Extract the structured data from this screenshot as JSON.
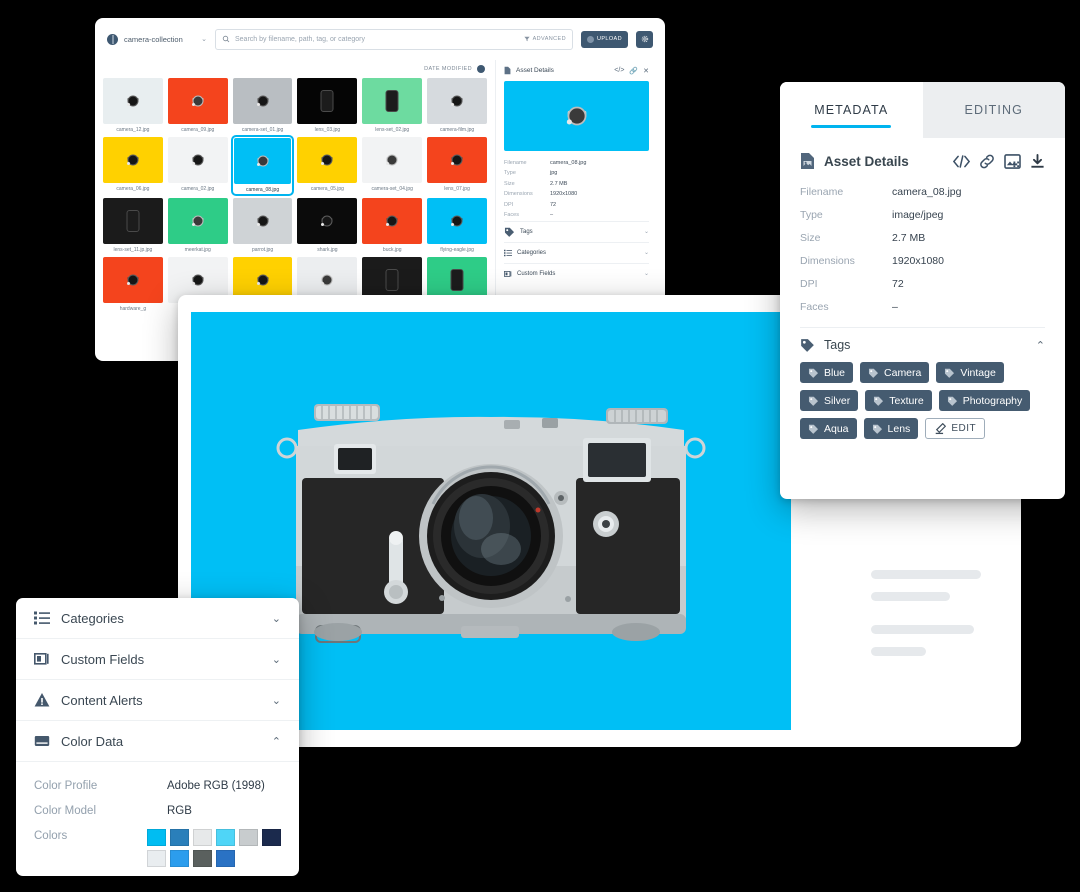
{
  "theme": {
    "accent": "#00b4ef",
    "dark_blue": "#3e5871",
    "tag_bg": "#455b70",
    "hero_bg": "#00bff5",
    "page_bg": "#000000"
  },
  "grid_window": {
    "collection": {
      "name": "camera-collection",
      "icon": "globe-icon",
      "chevron": "⌄"
    },
    "search": {
      "placeholder": "Search by filename, path, tag, or category",
      "icon": "search-icon"
    },
    "advanced_label": "ADVANCED",
    "advanced_icon": "filter-icon",
    "upload_label": "UPLOAD",
    "settings_icon": "gear-icon",
    "sort_label": "DATE MODIFIED",
    "sort_icon": "sort-order-icon",
    "thumbnails": [
      {
        "filename": "camera_12.jpg",
        "bg": "#e8eef0",
        "art": "camera-dark",
        "selected": false
      },
      {
        "filename": "camera_09.jpg",
        "bg": "#f4441d",
        "art": "camera-light",
        "selected": false
      },
      {
        "filename": "camera-set_01.jpg",
        "bg": "#b9bec2",
        "art": "camera-dark",
        "selected": false
      },
      {
        "filename": "lens_03.jpg",
        "bg": "#050505",
        "art": "lens",
        "selected": false
      },
      {
        "filename": "lens-set_02.jpg",
        "bg": "#6ddba0",
        "art": "lens",
        "selected": false
      },
      {
        "filename": "camera-film.jpg",
        "bg": "#d6dade",
        "art": "camera-dark",
        "selected": false
      },
      {
        "filename": "camera_06.jpg",
        "bg": "#ffd100",
        "art": "camera-dark",
        "selected": false
      },
      {
        "filename": "camera_02.jpg",
        "bg": "#f2f3f4",
        "art": "camera-dark",
        "selected": false
      },
      {
        "filename": "camera_08.jpg",
        "bg": "#00bff5",
        "art": "camera-light",
        "selected": true
      },
      {
        "filename": "camera_05.jpg",
        "bg": "#ffd100",
        "art": "camera-dark",
        "selected": false
      },
      {
        "filename": "camera-set_04.jpg",
        "bg": "#f2f3f4",
        "art": "camera-light",
        "selected": false
      },
      {
        "filename": "lens_07.jpg",
        "bg": "#f4441d",
        "art": "camera-dark",
        "selected": false
      },
      {
        "filename": "lens-set_11.jp.jpg",
        "bg": "#1b1b1b",
        "art": "lens",
        "selected": false
      },
      {
        "filename": "meerkat.jpg",
        "bg": "#2ecc87",
        "art": "camera-light",
        "selected": false
      },
      {
        "filename": "parrot.jpg",
        "bg": "#cfd3d6",
        "art": "camera-dark",
        "selected": false
      },
      {
        "filename": "shark.jpg",
        "bg": "#0b0b0b",
        "art": "camera-dark",
        "selected": false
      },
      {
        "filename": "buck.jpg",
        "bg": "#f4441d",
        "art": "camera-dark",
        "selected": false
      },
      {
        "filename": "flying-eagle.jpg",
        "bg": "#00bff5",
        "art": "camera-dark",
        "selected": false
      },
      {
        "filename": "hardware_g",
        "bg": "#f4441d",
        "art": "camera-dark",
        "selected": false
      },
      {
        "filename": "",
        "bg": "#f2f3f4",
        "art": "camera-dark",
        "selected": false
      },
      {
        "filename": "",
        "bg": "#ffd100",
        "art": "camera-dark",
        "selected": false
      },
      {
        "filename": "",
        "bg": "#eceef0",
        "art": "camera-light",
        "selected": false
      },
      {
        "filename": "",
        "bg": "#1b1b1b",
        "art": "lens",
        "selected": false
      },
      {
        "filename": "",
        "bg": "#2ecc87",
        "art": "lens",
        "selected": false
      }
    ],
    "inspector": {
      "title": "Asset Details",
      "actions": [
        "embed-code-icon",
        "link-icon",
        "close-icon"
      ],
      "preview_bg": "#00bff5",
      "fields": [
        {
          "key": "Filename",
          "value": "camera_08.jpg"
        },
        {
          "key": "Type",
          "value": "jpg"
        },
        {
          "key": "Size",
          "value": "2.7 MB"
        },
        {
          "key": "Dimensions",
          "value": "1920x1080"
        },
        {
          "key": "DPI",
          "value": "72"
        },
        {
          "key": "Faces",
          "value": "–"
        }
      ],
      "sections": [
        {
          "label": "Tags",
          "icon": "tag-icon",
          "chevron": "⌄"
        },
        {
          "label": "Categories",
          "icon": "list-icon",
          "chevron": "⌄"
        },
        {
          "label": "Custom Fields",
          "icon": "fields-icon",
          "chevron": "⌄"
        }
      ]
    }
  },
  "hero": {
    "background": "#00bff5",
    "image_alt": "vintage-rangefinder-camera",
    "skeleton_bars": 4
  },
  "metadata_panel": {
    "tabs": [
      {
        "label": "METADATA",
        "active": true
      },
      {
        "label": "EDITING",
        "active": false
      }
    ],
    "header": {
      "title": "Asset Details",
      "icon": "document-icon",
      "actions": [
        "embed-code-icon",
        "link-icon",
        "transparency-icon",
        "download-icon"
      ]
    },
    "fields": [
      {
        "key": "Filename",
        "value": "camera_08.jpg"
      },
      {
        "key": "Type",
        "value": "image/jpeg"
      },
      {
        "key": "Size",
        "value": "2.7 MB"
      },
      {
        "key": "Dimensions",
        "value": "1920x1080"
      },
      {
        "key": "DPI",
        "value": "72"
      },
      {
        "key": "Faces",
        "value": "–"
      }
    ],
    "tags_section": {
      "label": "Tags",
      "icon": "tag-icon",
      "chevron": "⌃",
      "tags": [
        "Blue",
        "Camera",
        "Vintage",
        "Silver",
        "Texture",
        "Photography",
        "Aqua",
        "Lens"
      ],
      "edit_label": "EDIT",
      "edit_icon": "pencil-icon"
    }
  },
  "color_panel": {
    "sections": [
      {
        "label": "Categories",
        "icon": "list-icon",
        "chevron": "⌄",
        "expanded": false
      },
      {
        "label": "Custom Fields",
        "icon": "fields-icon",
        "chevron": "⌄",
        "expanded": false
      },
      {
        "label": "Content Alerts",
        "icon": "warning-icon",
        "chevron": "⌄",
        "expanded": false
      },
      {
        "label": "Color Data",
        "icon": "color-data-icon",
        "chevron": "⌃",
        "expanded": true
      }
    ],
    "color_profile": {
      "key": "Color Profile",
      "value": "Adobe RGB (1998)"
    },
    "color_model": {
      "key": "Color Model",
      "value": "RGB"
    },
    "colors_label": "Colors",
    "swatches": [
      "#00bdf2",
      "#2a7fba",
      "#e7e9ea",
      "#4fd5f7",
      "#c8ccce",
      "#1b2a4d",
      "#e9edf0",
      "#2c9ded",
      "#5a605e",
      "#2a72c4"
    ]
  }
}
